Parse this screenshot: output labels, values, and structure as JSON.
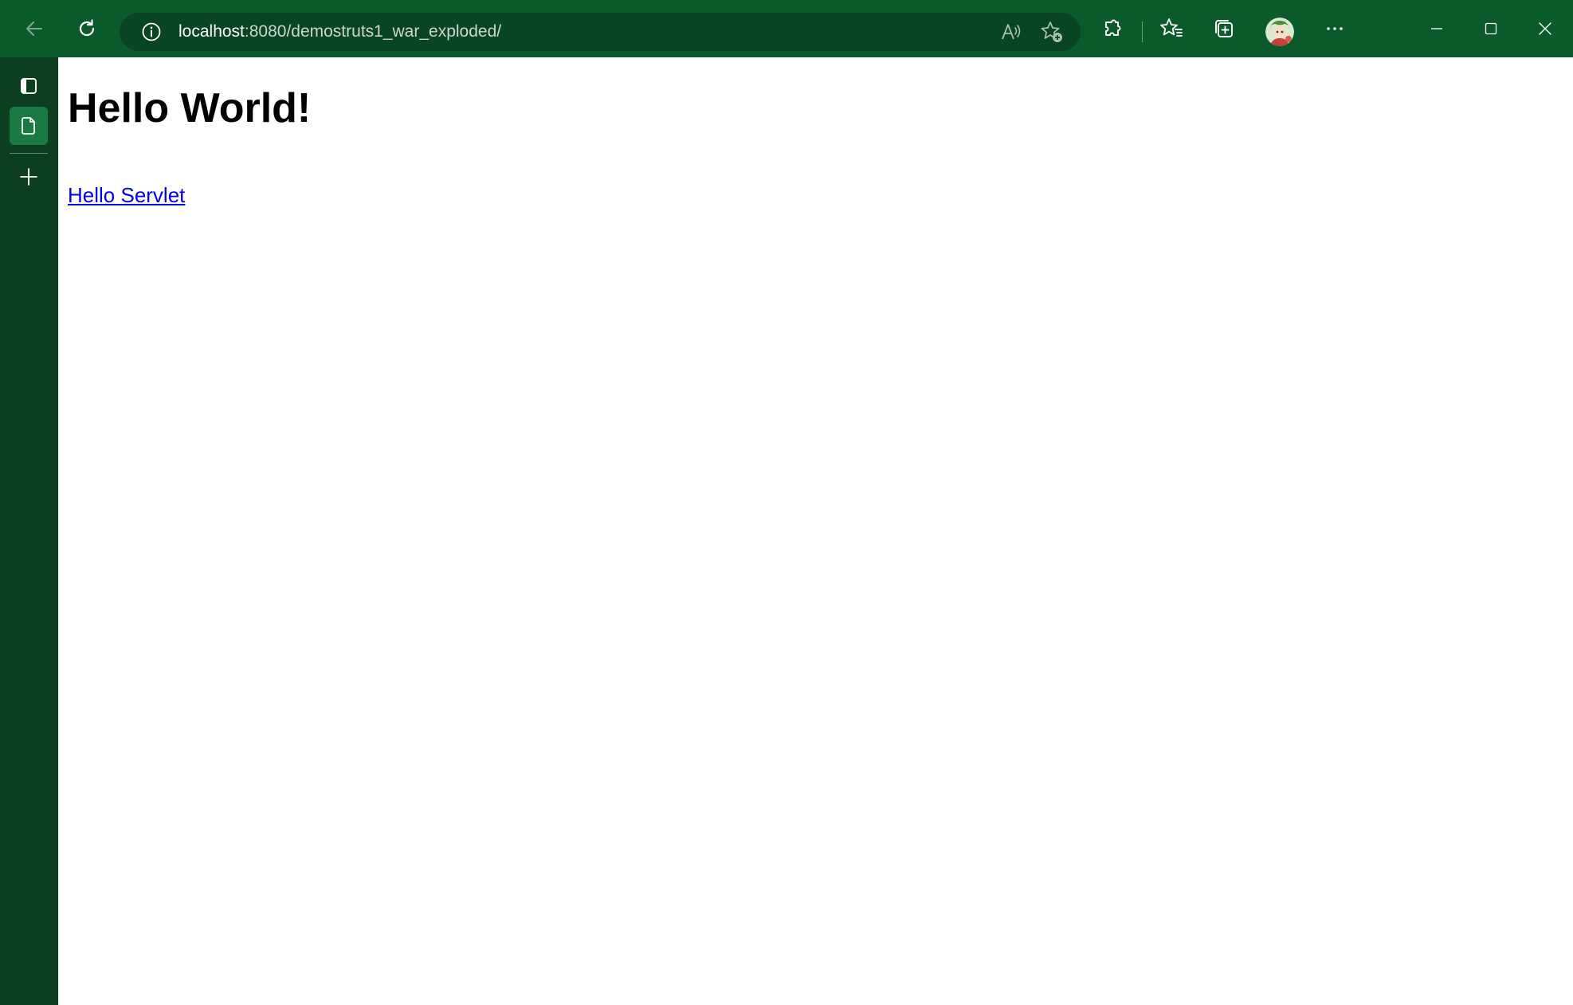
{
  "toolbar": {
    "url_host": "localhost",
    "url_rest": ":8080/demostruts1_war_exploded/",
    "icons": [
      "back-arrow-icon",
      "refresh-icon",
      "site-info-icon",
      "read-aloud-icon",
      "add-favorite-icon",
      "extensions-icon",
      "favorites-icon",
      "collections-icon",
      "profile-avatar",
      "more-icon",
      "minimize-icon",
      "maximize-icon",
      "close-icon"
    ]
  },
  "sidebar": {
    "icons": [
      "tab-actions-icon",
      "page-tab-icon",
      "new-tab-icon"
    ]
  },
  "page": {
    "title": "Hello World!",
    "link_text": "Hello Servlet"
  },
  "colors": {
    "toolbar_bg": "#0b5a2c",
    "address_bg": "#094522",
    "sidebar_bg": "#0b3f20",
    "active_tab_bg": "#1b7a43",
    "link": "#0000ee"
  }
}
